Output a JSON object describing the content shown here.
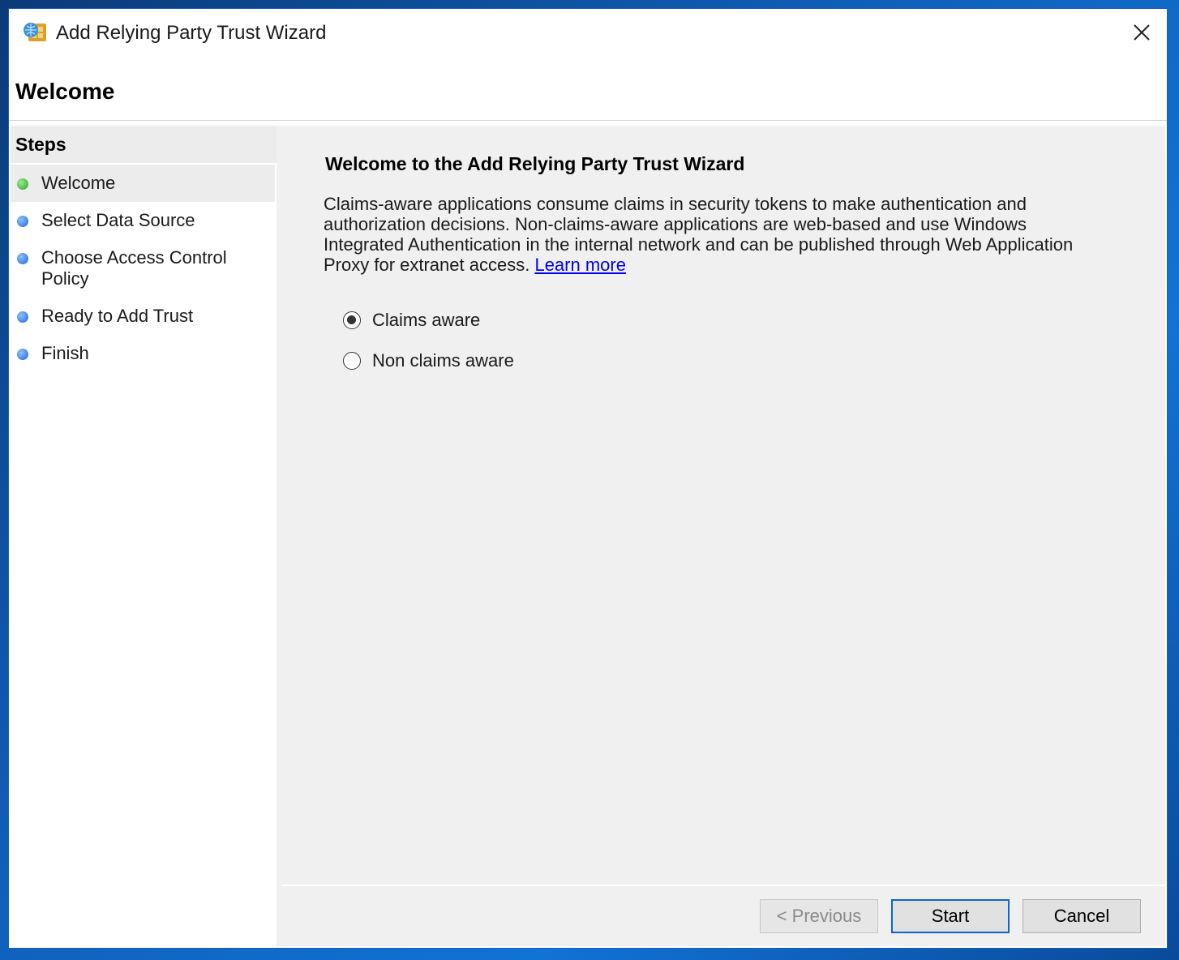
{
  "window": {
    "title": "Add Relying Party Trust Wizard",
    "close_icon": "close-icon"
  },
  "header": {
    "title": "Welcome"
  },
  "sidebar": {
    "heading": "Steps",
    "items": [
      {
        "label": "Welcome",
        "status": "current",
        "color": "#2ea52a"
      },
      {
        "label": "Select Data Source",
        "status": "pending",
        "color": "#1f64d8"
      },
      {
        "label": "Choose Access Control Policy",
        "status": "pending",
        "color": "#1f64d8"
      },
      {
        "label": "Ready to Add Trust",
        "status": "pending",
        "color": "#1f64d8"
      },
      {
        "label": "Finish",
        "status": "pending",
        "color": "#1f64d8"
      }
    ]
  },
  "main": {
    "heading": "Welcome to the Add Relying Party Trust Wizard",
    "description": "Claims-aware applications consume claims in security tokens to make authentication and authorization decisions. Non-claims-aware applications are web-based and use Windows Integrated Authentication in the internal network and can be published through Web Application Proxy for extranet access.",
    "learn_more": "Learn more",
    "options": [
      {
        "label": "Claims aware",
        "selected": true
      },
      {
        "label": "Non claims aware",
        "selected": false
      }
    ]
  },
  "footer": {
    "previous_label": "< Previous",
    "start_label": "Start",
    "cancel_label": "Cancel"
  }
}
